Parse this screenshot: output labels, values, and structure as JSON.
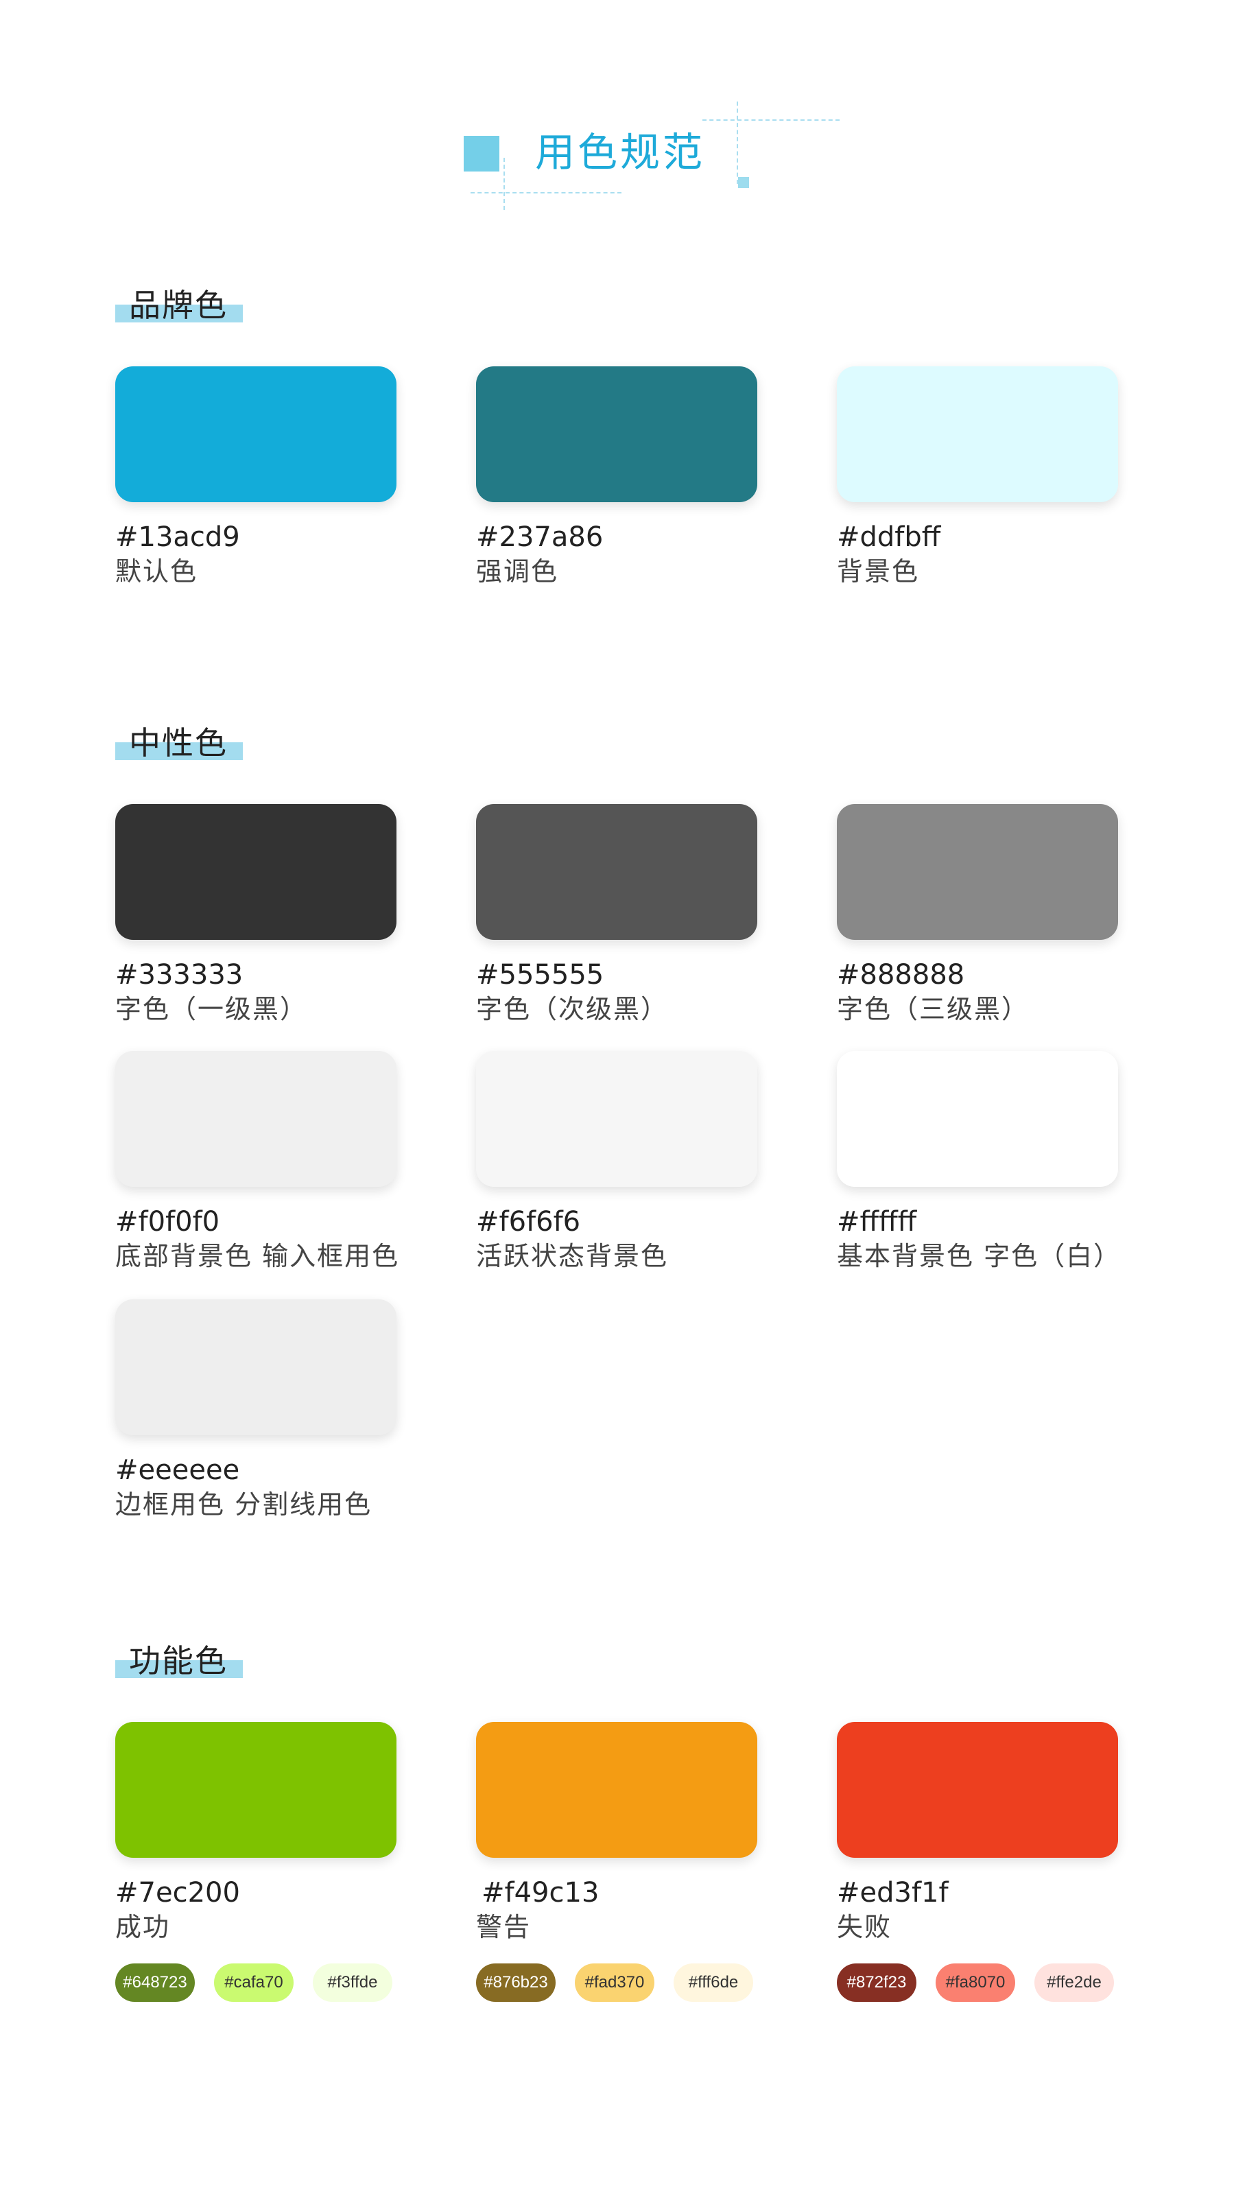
{
  "page": {
    "title": "用色规范"
  },
  "brand": {
    "heading": "品牌色",
    "swatches": [
      {
        "hex": "#13acd9",
        "label": "默认色"
      },
      {
        "hex": "#237a86",
        "label": "强调色"
      },
      {
        "hex": "#ddfbff",
        "label": "背景色"
      }
    ]
  },
  "neutral": {
    "heading": "中性色",
    "swatches": [
      {
        "hex": "#333333",
        "label": "字色（一级黑）"
      },
      {
        "hex": "#555555",
        "label": "字色（次级黑）"
      },
      {
        "hex": "#888888",
        "label": "字色（三级黑）"
      },
      {
        "hex": "#f0f0f0",
        "label": "底部背景色 输入框用色"
      },
      {
        "hex": "#f6f6f6",
        "label": "活跃状态背景色"
      },
      {
        "hex": "#ffffff",
        "label": "基本背景色 字色（白）"
      },
      {
        "hex": "#eeeeee",
        "label": "边框用色 分割线用色"
      }
    ]
  },
  "functional": {
    "heading": "功能色",
    "swatches": [
      {
        "hex": "#7ec200",
        "label": "成功",
        "variants": [
          {
            "hex": "#648723",
            "text_color": "#ffffff"
          },
          {
            "hex": "#cafa70",
            "text_color": "#333333"
          },
          {
            "hex": "#f3ffde",
            "text_color": "#333333"
          }
        ]
      },
      {
        "hex": "#f49c13",
        "label": "警告",
        "variants": [
          {
            "hex": "#876b23",
            "text_color": "#ffffff"
          },
          {
            "hex": "#fad370",
            "text_color": "#333333"
          },
          {
            "hex": "#fff6de",
            "text_color": "#333333"
          }
        ]
      },
      {
        "hex": "#ed3f1f",
        "label": "失败",
        "variants": [
          {
            "hex": "#872f23",
            "text_color": "#ffffff"
          },
          {
            "hex": "#fa8070",
            "text_color": "#333333"
          },
          {
            "hex": "#ffe2de",
            "text_color": "#333333"
          }
        ]
      }
    ]
  }
}
